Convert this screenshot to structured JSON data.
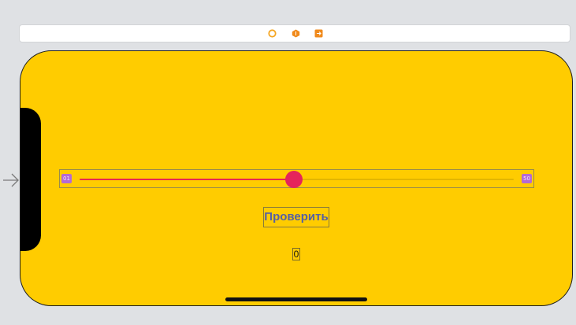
{
  "scene_dock": {
    "icons": [
      "view-controller-icon",
      "first-responder-icon",
      "exit-icon"
    ]
  },
  "entry_point": {
    "icon": "entry-arrow-icon"
  },
  "device": {
    "background_color": "#ffcc00"
  },
  "slider": {
    "min_image_label": "01",
    "max_image_label": "50",
    "value_fraction": 0.494,
    "min_track_color": "#e8294f",
    "thumb_color": "#e5245b"
  },
  "check_button": {
    "label": "Проверить"
  },
  "result_label": {
    "text": "0"
  }
}
